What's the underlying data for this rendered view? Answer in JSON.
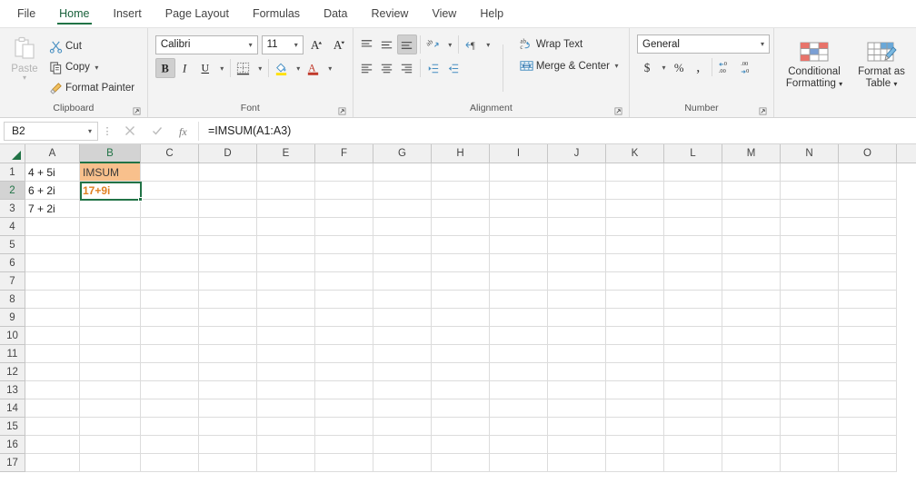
{
  "tabs": [
    {
      "label": "File",
      "active": false
    },
    {
      "label": "Home",
      "active": true
    },
    {
      "label": "Insert",
      "active": false
    },
    {
      "label": "Page Layout",
      "active": false
    },
    {
      "label": "Formulas",
      "active": false
    },
    {
      "label": "Data",
      "active": false
    },
    {
      "label": "Review",
      "active": false
    },
    {
      "label": "View",
      "active": false
    },
    {
      "label": "Help",
      "active": false
    }
  ],
  "ribbon": {
    "clipboard": {
      "label": "Clipboard",
      "paste": "Paste",
      "cut": "Cut",
      "copy": "Copy",
      "format_painter": "Format Painter"
    },
    "font": {
      "label": "Font",
      "font_name": "Calibri",
      "font_size": "11",
      "bold": "B",
      "italic": "I",
      "underline": "U"
    },
    "alignment": {
      "label": "Alignment",
      "wrap_text": "Wrap Text",
      "merge_center": "Merge & Center"
    },
    "number": {
      "label": "Number",
      "format": "General",
      "currency": "$",
      "percent": "%",
      "comma": "'"
    },
    "styles": {
      "conditional_formatting": "Conditional Formatting",
      "format_as_table": "Format as Table"
    }
  },
  "formula_bar": {
    "name_box": "B2",
    "formula": "=IMSUM(A1:A3)"
  },
  "grid": {
    "columns": [
      "A",
      "B",
      "C",
      "D",
      "E",
      "F",
      "G",
      "H",
      "I",
      "J",
      "K",
      "L",
      "M",
      "N",
      "O"
    ],
    "selected_column": "B",
    "selected_row": "2",
    "rows": [
      "1",
      "2",
      "3",
      "4",
      "5",
      "6",
      "7",
      "8",
      "9",
      "10",
      "11",
      "12",
      "13",
      "14",
      "15",
      "16",
      "17"
    ],
    "cells": {
      "A1": "4 + 5i",
      "A2": "6 + 2i",
      "A3": "7 + 2i",
      "B1": "IMSUM",
      "B2": "17+9i"
    }
  },
  "colors": {
    "accent": "#217346",
    "header_fill": "#f8c08c",
    "result_text": "#e08020"
  }
}
